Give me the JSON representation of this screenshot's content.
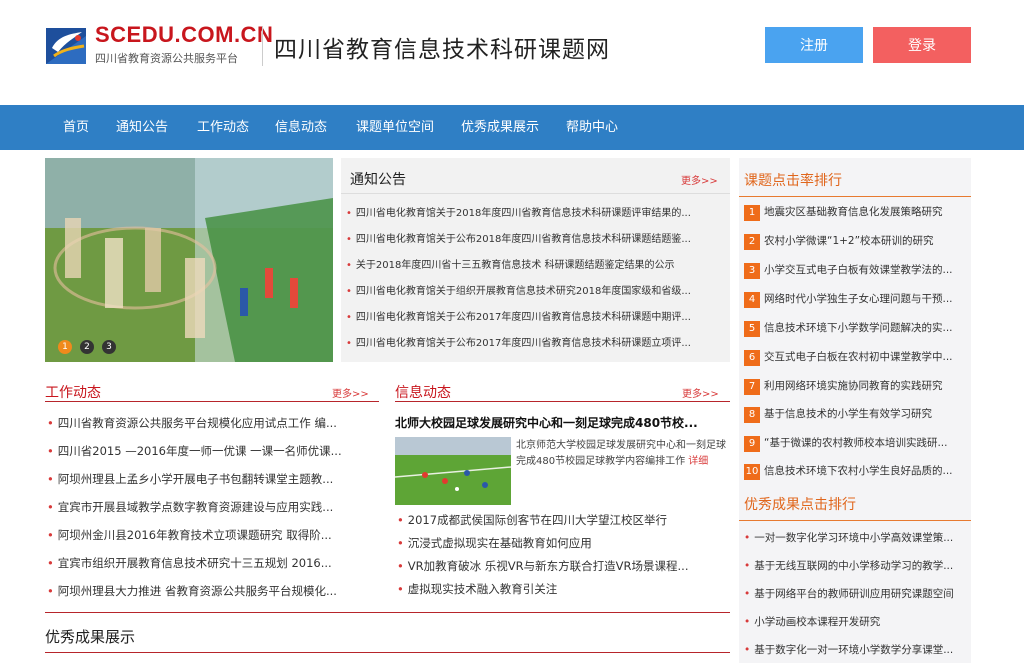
{
  "header": {
    "logo_en": "SCEDU.COM.CN",
    "logo_cn": "四川省教育资源公共服务平台",
    "site_title": "四川省教育信息技术科研课题网",
    "register_label": "注册",
    "login_label": "登录"
  },
  "nav": {
    "items": [
      "首页",
      "通知公告",
      "工作动态",
      "信息动态",
      "课题单位空间",
      "优秀成果展示",
      "帮助中心"
    ]
  },
  "carousel": {
    "dots": [
      "1",
      "2",
      "3"
    ],
    "active": 0
  },
  "notice": {
    "title": "通知公告",
    "more": "更多>>",
    "items": [
      "四川省电化教育馆关于2018年度四川省教育信息技术科研课题评审结果的...",
      "四川省电化教育馆关于公布2018年度四川省教育信息技术科研课题结题鉴...",
      "关于2018年度四川省十三五教育信息技术 科研课题结题鉴定结果的公示",
      "四川省电化教育馆关于组织开展教育信息技术研究2018年度国家级和省级...",
      "四川省电化教育馆关于公布2017年度四川省教育信息技术科研课题中期评...",
      "四川省电化教育馆关于公布2017年度四川省教育信息技术科研课题立项评..."
    ]
  },
  "work": {
    "title": "工作动态",
    "more": "更多>>",
    "items": [
      "四川省教育资源公共服务平台规模化应用试点工作 编...",
      "四川省2015 —2016年度一师一优课 一课一名师优课...",
      "阿坝州理县上孟乡小学开展电子书包翻转课堂主题教...",
      "宜宾市开展县域教学点数字教育资源建设与应用实践...",
      "阿坝州金川县2016年教育技术立项课题研究 取得阶...",
      "宜宾市组织开展教育信息技术研究十三五规划 2016...",
      "阿坝州理县大力推进 省教育资源公共服务平台规模化..."
    ]
  },
  "info": {
    "title": "信息动态",
    "more": "更多>>",
    "headline": "北师大校园足球发展研究中心和一刻足球完成480节校...",
    "summary": "北京师范大学校园足球发展研究中心和一刻足球完成480节校园足球教学内容编排工作",
    "detail_label": "详细",
    "items": [
      "2017成都武侯国际创客节在四川大学望江校区举行",
      "沉浸式虚拟现实在基础教育如何应用",
      "VR加教育破冰 乐视VR与新东方联合打造VR场景课程...",
      "虚拟现实技术融入教育引关注"
    ]
  },
  "achievements": {
    "title": "优秀成果展示"
  },
  "sidebar": {
    "rank_title": "课题点击率排行",
    "rank_items": [
      {
        "num": "1",
        "text": "地震灾区基础教育信息化发展策略研究"
      },
      {
        "num": "2",
        "text": "农村小学微课“1+2”校本研训的研究"
      },
      {
        "num": "3",
        "text": "小学交互式电子白板有效课堂教学法的..."
      },
      {
        "num": "4",
        "text": "网络时代小学独生子女心理问题与干预..."
      },
      {
        "num": "5",
        "text": "信息技术环境下小学数学问题解决的实..."
      },
      {
        "num": "6",
        "text": "交互式电子白板在农村初中课堂教学中..."
      },
      {
        "num": "7",
        "text": "利用网络环境实施协同教育的实践研究"
      },
      {
        "num": "8",
        "text": "基于信息技术的小学生有效学习研究"
      },
      {
        "num": "9",
        "text": "“基于微课的农村教师校本培训实践研..."
      },
      {
        "num": "10",
        "text": "信息技术环境下农村小学生良好品质的..."
      }
    ],
    "achieve_title": "优秀成果点击排行",
    "achieve_items": [
      "一对一数字化学习环境中小学高效课堂策...",
      "基于无线互联网的中小学移动学习的教学...",
      "基于网络平台的教师研训应用研究课题空间",
      "小学动画校本课程开发研究",
      "基于数字化一对一环境小学数学分享课堂..."
    ]
  },
  "colors": {
    "nav_bg": "#2f7fc5",
    "accent_red": "#c8161d",
    "accent_orange": "#ef6c1a",
    "register_bg": "#4aa3f0",
    "login_bg": "#f36060"
  }
}
